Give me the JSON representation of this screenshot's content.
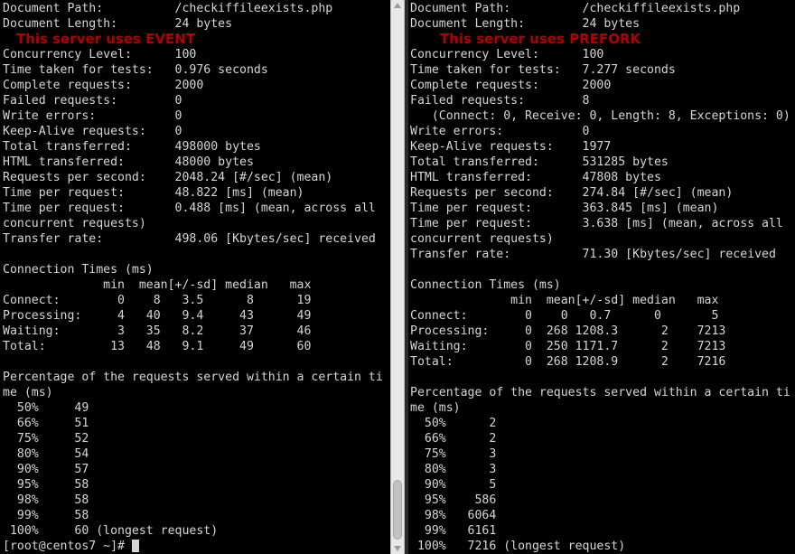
{
  "left": {
    "overlay": "This server uses EVENT",
    "lines": [
      "Document Path:          /checkiffileexists.php",
      "Document Length:        24 bytes",
      "",
      "Concurrency Level:      100",
      "Time taken for tests:   0.976 seconds",
      "Complete requests:      2000",
      "Failed requests:        0",
      "Write errors:           0",
      "Keep-Alive requests:    0",
      "Total transferred:      498000 bytes",
      "HTML transferred:       48000 bytes",
      "Requests per second:    2048.24 [#/sec] (mean)",
      "Time per request:       48.822 [ms] (mean)",
      "Time per request:       0.488 [ms] (mean, across all",
      "concurrent requests)",
      "Transfer rate:          498.06 [Kbytes/sec] received",
      "",
      "Connection Times (ms)",
      "              min  mean[+/-sd] median   max",
      "Connect:        0    8   3.5      8      19",
      "Processing:     4   40   9.4     43      49",
      "Waiting:        3   35   8.2     37      46",
      "Total:         13   48   9.1     49      60",
      "",
      "Percentage of the requests served within a certain ti",
      "me (ms)",
      "  50%     49",
      "  66%     51",
      "  75%     52",
      "  80%     54",
      "  90%     57",
      "  95%     58",
      "  98%     58",
      "  99%     58",
      " 100%     60 (longest request)",
      "[root@centos7 ~]# "
    ]
  },
  "right": {
    "overlay": "This server uses PREFORK",
    "lines": [
      "Document Path:          /checkiffileexists.php",
      "Document Length:        24 bytes",
      "",
      "Concurrency Level:      100",
      "Time taken for tests:   7.277 seconds",
      "Complete requests:      2000",
      "Failed requests:        8",
      "   (Connect: 0, Receive: 0, Length: 8, Exceptions: 0)",
      "Write errors:           0",
      "Keep-Alive requests:    1977",
      "Total transferred:      531285 bytes",
      "HTML transferred:       47808 bytes",
      "Requests per second:    274.84 [#/sec] (mean)",
      "Time per request:       363.845 [ms] (mean)",
      "Time per request:       3.638 [ms] (mean, across all",
      "concurrent requests)",
      "Transfer rate:          71.30 [Kbytes/sec] received",
      "",
      "Connection Times (ms)",
      "              min  mean[+/-sd] median   max",
      "Connect:        0    0   0.7      0       5",
      "Processing:     0  268 1208.3      2    7213",
      "Waiting:        0  250 1171.7      2    7213",
      "Total:          0  268 1208.9      2    7216",
      "",
      "Percentage of the requests served within a certain ti",
      "me (ms)",
      "  50%      2",
      "  66%      2",
      "  75%      3",
      "  80%      3",
      "  90%      5",
      "  95%    586",
      "  98%   6064",
      "  99%   6161",
      " 100%   7216 (longest request)"
    ]
  },
  "colors": {
    "background": "#000000",
    "text": "#d6d6d6",
    "overlay": "#b00000"
  }
}
